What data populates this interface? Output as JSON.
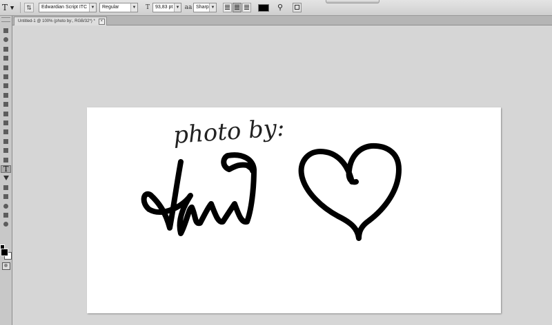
{
  "options_bar": {
    "tool_glyph": "T",
    "font_family": "Edwardian Script ITC",
    "font_style": "Regular",
    "font_size": "93,83 pt",
    "antialias": "Sharp",
    "text_color": "#000000"
  },
  "document": {
    "tab_title": "Untitled-1 @ 100% (photo by:, RGB/32*) *",
    "tab_close": "×"
  },
  "canvas_content": {
    "caption": "photo by:"
  },
  "colors": {
    "foreground": "#000000",
    "background": "#ffffff"
  }
}
